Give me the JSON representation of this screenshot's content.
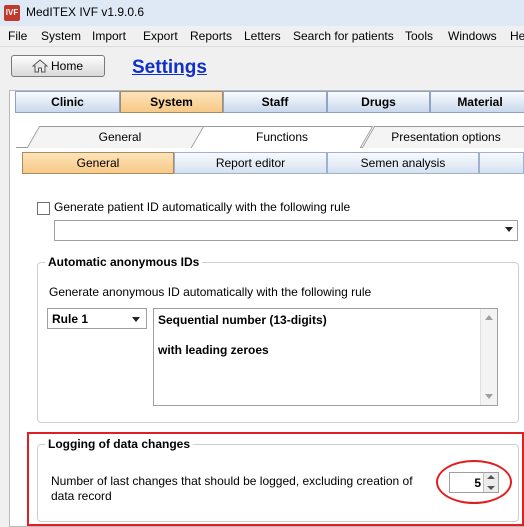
{
  "window": {
    "title": "MedITEX IVF v1.9.0.6",
    "app_icon": "meditex-logo-icon"
  },
  "menu": [
    "File",
    "System",
    "Import",
    "Export",
    "Reports",
    "Letters",
    "Search for patients",
    "Tools",
    "Windows",
    "He"
  ],
  "toolbar": {
    "home_label": "Home",
    "home_icon": "home-icon"
  },
  "page": {
    "title": "Settings"
  },
  "main_tabs": [
    "Clinic",
    "System",
    "Staff",
    "Drugs",
    "Material"
  ],
  "main_tabs_active": "System",
  "sub_tabs": [
    "General",
    "Functions",
    "Presentation options"
  ],
  "sub_tabs_active": "Functions",
  "function_tabs": [
    "General",
    "Report editor",
    "Semen analysis"
  ],
  "function_tabs_active": "General",
  "patient_id": {
    "checkbox_label": "Generate patient ID automatically with the following rule",
    "checked": false,
    "rule_value": ""
  },
  "anonymous_ids": {
    "group_title": "Automatic anonymous IDs",
    "description": "Generate anonymous ID automatically with the following rule",
    "rule_selected": "Rule 1",
    "rule_text_line1": "Sequential number  (13-digits)",
    "rule_text_line2": "with leading zeroes"
  },
  "logging": {
    "group_title": "Logging of data changes",
    "description": "Number of last changes that should be logged, excluding creation of data record",
    "value": "5"
  },
  "colors": {
    "link_blue": "#1030c8",
    "active_tab": "#f7c987",
    "highlight_red": "#e02020"
  }
}
